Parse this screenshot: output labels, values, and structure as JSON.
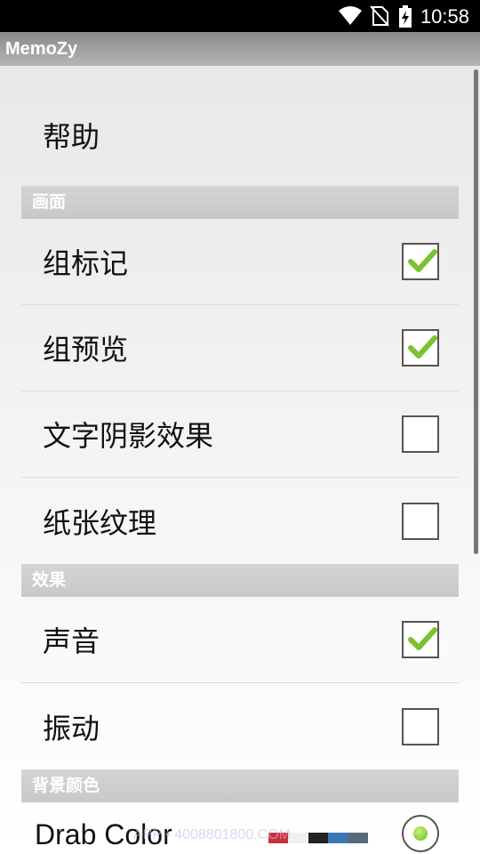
{
  "status_bar": {
    "time": "10:58",
    "icons": [
      "wifi-icon",
      "no-sim-icon",
      "battery-charging-icon"
    ]
  },
  "app_bar": {
    "title": "MemoZy"
  },
  "help": {
    "label": "帮助"
  },
  "sections": {
    "display": {
      "header": "画面",
      "items": [
        {
          "label": "组标记",
          "checked": true
        },
        {
          "label": "组预览",
          "checked": true
        },
        {
          "label": "文字阴影效果",
          "checked": false
        },
        {
          "label": "纸张纹理",
          "checked": false
        }
      ]
    },
    "effects": {
      "header": "效果",
      "items": [
        {
          "label": "声音",
          "checked": true
        },
        {
          "label": "振动",
          "checked": false
        }
      ]
    },
    "background": {
      "header": "背景颜色",
      "items": [
        {
          "label": "Drab Color",
          "selected": true,
          "swatch": [
            "#c9303a",
            "#f0f0f0",
            "#222222",
            "#3a78b5",
            "#586a7a"
          ]
        }
      ]
    }
  },
  "watermark": "APP • 4008801800.COM",
  "colors": {
    "check": "#7ac231",
    "section_bg": "#cccccc",
    "statusbar": "#000000"
  }
}
